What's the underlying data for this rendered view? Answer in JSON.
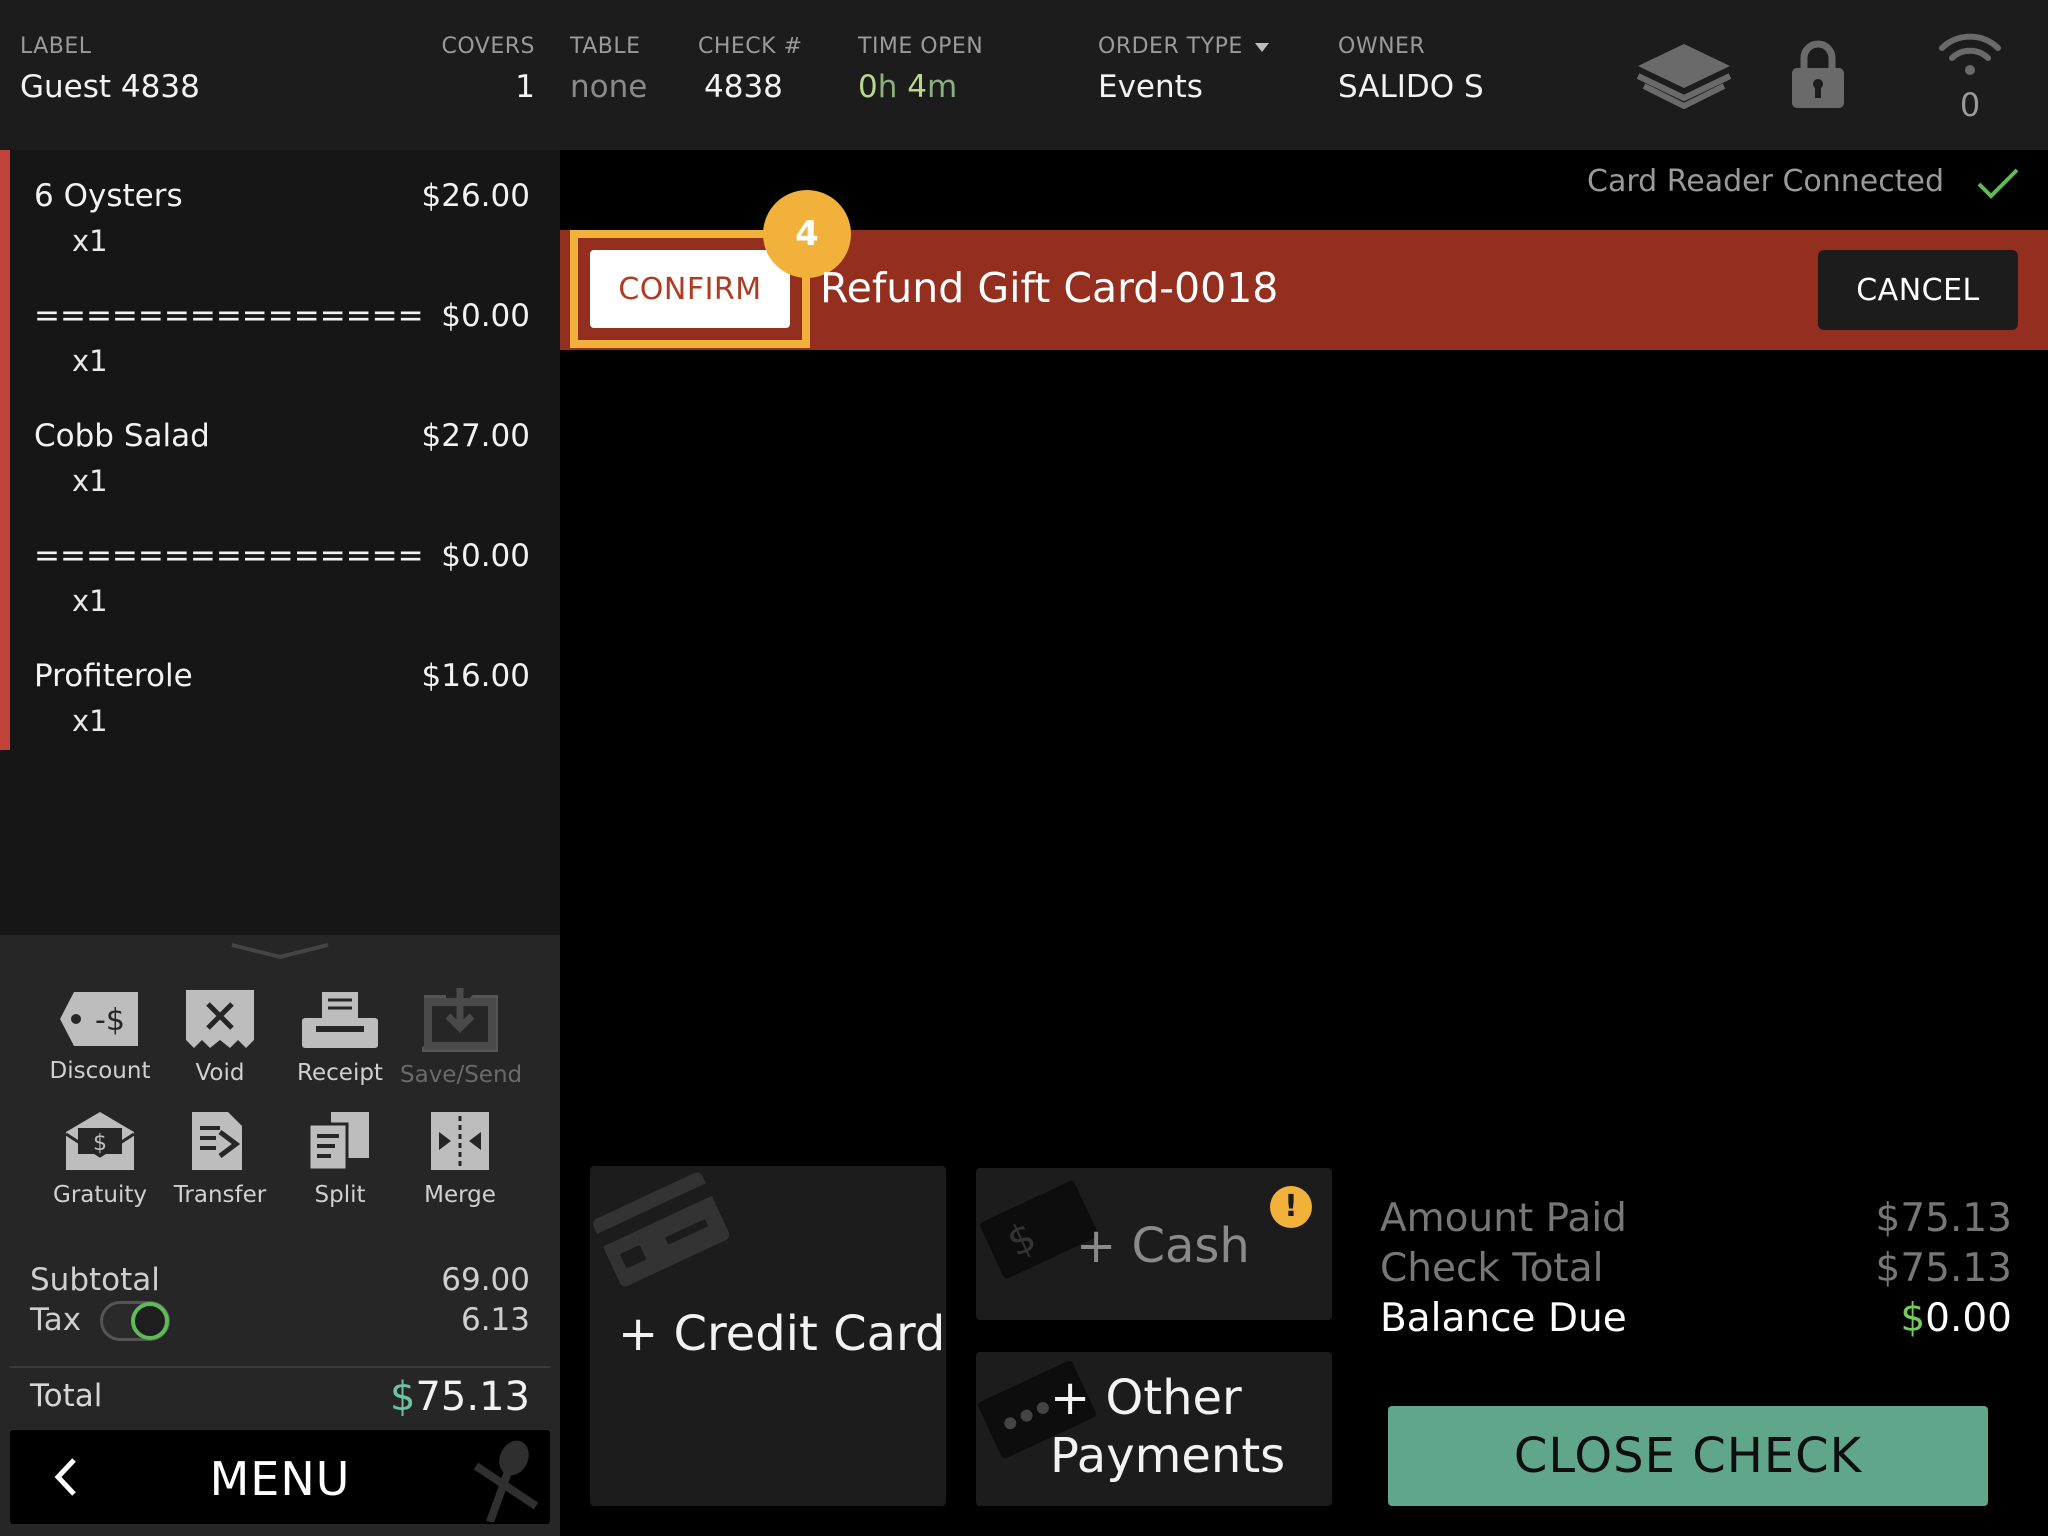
{
  "header": {
    "label": {
      "title": "LABEL",
      "value": "Guest 4838"
    },
    "covers": {
      "title": "COVERS",
      "value": "1"
    },
    "table": {
      "title": "TABLE",
      "value": "none"
    },
    "check": {
      "title": "CHECK #",
      "value": "4838"
    },
    "time_open": {
      "title": "TIME OPEN",
      "hours": "0",
      "hours_unit": "h",
      "minutes": "4",
      "minutes_unit": "m"
    },
    "order_type": {
      "title": "ORDER TYPE",
      "value": "Events"
    },
    "owner": {
      "title": "OWNER",
      "value": "SALIDO S"
    },
    "wifi_count": "0"
  },
  "order_items": [
    {
      "name": "6 Oysters",
      "price": "$26.00",
      "qty": "x1"
    },
    {
      "name": "===============",
      "price": "$0.00",
      "qty": "x1"
    },
    {
      "name": "Cobb Salad",
      "price": "$27.00",
      "qty": "x1"
    },
    {
      "name": "===============",
      "price": "$0.00",
      "qty": "x1"
    },
    {
      "name": "Profiterole",
      "price": "$16.00",
      "qty": "x1"
    }
  ],
  "tools": {
    "discount": "Discount",
    "void": "Void",
    "receipt": "Receipt",
    "save_send": "Save/Send",
    "gratuity": "Gratuity",
    "transfer": "Transfer",
    "split": "Split",
    "merge": "Merge",
    "discount_glyph": "-$",
    "gratuity_glyph": "$"
  },
  "summary": {
    "subtotal_label": "Subtotal",
    "subtotal_value": "69.00",
    "tax_label": "Tax",
    "tax_value": "6.13",
    "total_label": "Total",
    "total_currency": "$",
    "total_value": "75.13"
  },
  "menu_label": "MENU",
  "card_reader_status": "Card Reader Connected",
  "refund_banner": {
    "confirm_label": "CONFIRM",
    "step_number": "4",
    "title": "Refund Gift Card-0018",
    "cancel_label": "CANCEL"
  },
  "payments": {
    "credit_card": "+ Credit Card",
    "cash": "+ Cash",
    "cash_glyph": "$",
    "cash_warning": "!",
    "other_line1": "+ Other",
    "other_line2": "Payments"
  },
  "balance": {
    "amount_paid_label": "Amount Paid",
    "amount_paid_value": "$75.13",
    "check_total_label": "Check Total",
    "check_total_value": "$75.13",
    "balance_due_label": "Balance Due",
    "balance_due_currency": "$",
    "balance_due_value": "0.00"
  },
  "close_check_label": "CLOSE CHECK",
  "colors": {
    "banner_red": "#942e1e",
    "highlight_orange": "#f1b13b",
    "close_green": "#5fa68a",
    "order_accent": "#c0443a"
  }
}
